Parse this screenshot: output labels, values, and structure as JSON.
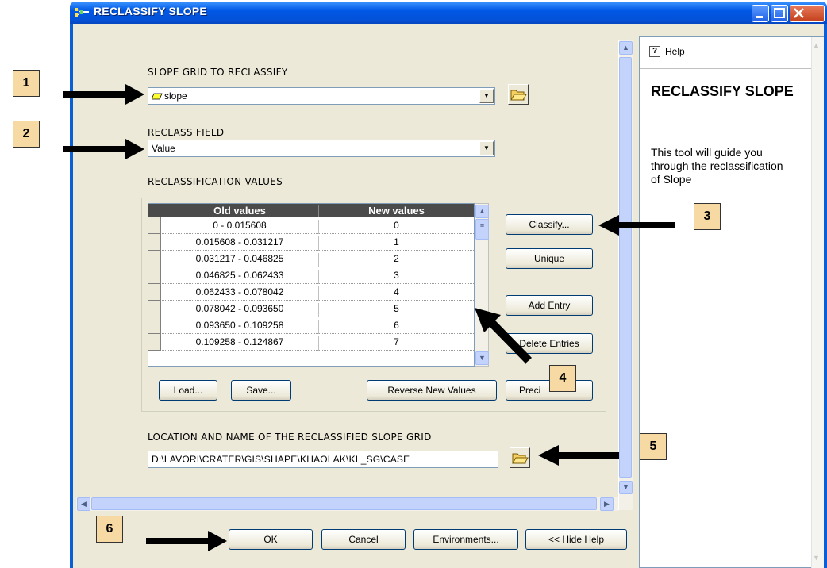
{
  "window": {
    "title": "RECLASSIFY SLOPE"
  },
  "slope_grid": {
    "label": "SLOPE GRID TO RECLASSIFY",
    "value": "slope"
  },
  "reclass_field": {
    "label": "RECLASS FIELD",
    "value": "Value"
  },
  "reclassification": {
    "label": "RECLASSIFICATION VALUES",
    "columns": [
      "Old values",
      "New values"
    ],
    "rows": [
      {
        "old": "0 - 0.015608",
        "new": "0"
      },
      {
        "old": "0.015608 - 0.031217",
        "new": "1"
      },
      {
        "old": "0.031217 - 0.046825",
        "new": "2"
      },
      {
        "old": "0.046825 - 0.062433",
        "new": "3"
      },
      {
        "old": "0.062433 - 0.078042",
        "new": "4"
      },
      {
        "old": "0.078042 - 0.093650",
        "new": "5"
      },
      {
        "old": "0.093650 - 0.109258",
        "new": "6"
      },
      {
        "old": "0.109258 - 0.124867",
        "new": "7"
      }
    ],
    "buttons": {
      "classify": "Classify...",
      "unique": "Unique",
      "add_entry": "Add Entry",
      "delete_entries": "Delete Entries",
      "load": "Load...",
      "save": "Save...",
      "reverse": "Reverse New Values",
      "precision": "Preci"
    }
  },
  "output": {
    "label": "LOCATION AND NAME OF THE RECLASSIFIED SLOPE GRID",
    "value": "D:\\LAVORI\\CRATER\\GIS\\SHAPE\\KHAOLAK\\KL_SG\\CASE"
  },
  "footer": {
    "ok": "OK",
    "cancel": "Cancel",
    "environments": "Environments...",
    "hide_help": "<< Hide Help"
  },
  "help": {
    "tab_label": "Help",
    "title": "RECLASSIFY SLOPE",
    "body": "This tool will guide you through the reclassification of Slope"
  },
  "callouts": [
    "1",
    "2",
    "3",
    "4",
    "5",
    "6"
  ],
  "colors": {
    "titlebar": "#0058e6",
    "dialog": "#ece9d8",
    "callout": "#f6d9a3",
    "table_header": "#4b4b4b"
  }
}
